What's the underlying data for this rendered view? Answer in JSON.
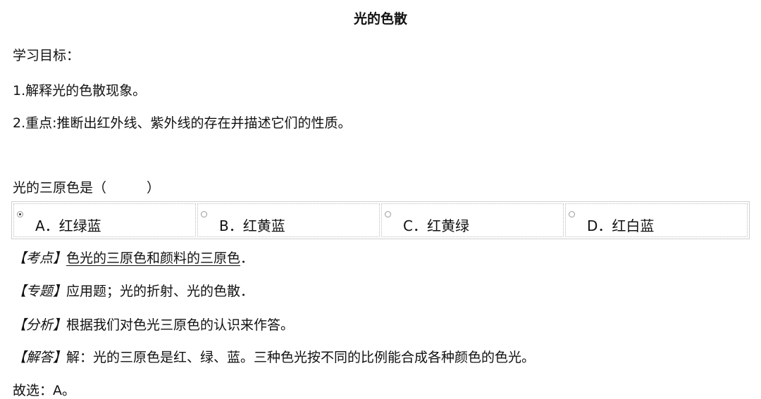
{
  "title": "光的色散",
  "objectives": {
    "heading": "学习目标：",
    "items": [
      "1.解释光的色散现象。",
      "2.重点:推断出红外线、紫外线的存在并描述它们的性质。"
    ]
  },
  "question": {
    "text": "光的三原色是（　　　）",
    "options": [
      {
        "label": "A．红绿蓝",
        "selected": true
      },
      {
        "label": "B．红黄蓝",
        "selected": false
      },
      {
        "label": "C．红黄绿",
        "selected": false
      },
      {
        "label": "D．红白蓝",
        "selected": false
      }
    ]
  },
  "analysis": {
    "kaodian": {
      "tag": "【考点】",
      "link": "色光的三原色和颜料的三原色",
      "suffix": "．"
    },
    "zhuanti": {
      "tag": "【专题】",
      "text": "应用题；光的折射、光的色散．"
    },
    "fenxi": {
      "tag": "【分析】",
      "text": "根据我们对色光三原色的认识来作答。"
    },
    "jieda": {
      "tag": "【解答】",
      "text": "解：光的三原色是红、绿、蓝。三种色光按不同的比例能合成各种颜色的色光。"
    },
    "answer": "故选：A。"
  }
}
